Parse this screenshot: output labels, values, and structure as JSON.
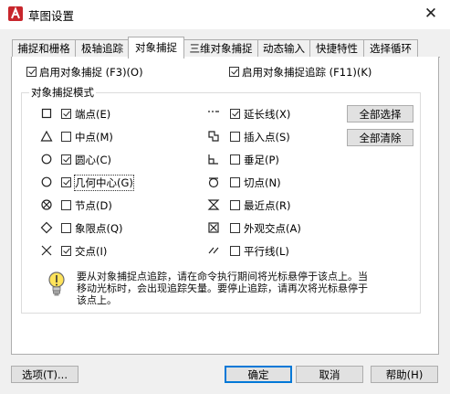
{
  "window": {
    "title": "草图设置",
    "close_glyph": "✕",
    "accent": "#c8262c"
  },
  "tabs": [
    {
      "label": "捕捉和栅格"
    },
    {
      "label": "极轴追踪"
    },
    {
      "label": "对象捕捉"
    },
    {
      "label": "三维对象捕捉"
    },
    {
      "label": "动态输入"
    },
    {
      "label": "快捷特性"
    },
    {
      "label": "选择循环"
    }
  ],
  "toggles": {
    "osnap_on": {
      "label": "启用对象捕捉 (F3)(O)",
      "checked": true
    },
    "otrack_on": {
      "label": "启用对象捕捉追踪 (F11)(K)",
      "checked": true
    }
  },
  "group_title": "对象捕捉模式",
  "modes_left": [
    {
      "label": "端点(E)",
      "checked": true,
      "icon": "endpoint-square-icon"
    },
    {
      "label": "中点(M)",
      "checked": false,
      "icon": "midpoint-triangle-icon"
    },
    {
      "label": "圆心(C)",
      "checked": true,
      "icon": "center-circle-icon"
    },
    {
      "label": "几何中心(G)",
      "checked": true,
      "icon": "geometric-center-icon"
    },
    {
      "label": "节点(D)",
      "checked": false,
      "icon": "node-icon"
    },
    {
      "label": "象限点(Q)",
      "checked": false,
      "icon": "quadrant-diamond-icon"
    },
    {
      "label": "交点(I)",
      "checked": true,
      "icon": "intersection-x-icon"
    }
  ],
  "modes_right": [
    {
      "label": "延长线(X)",
      "checked": true,
      "icon": "extension-icon"
    },
    {
      "label": "插入点(S)",
      "checked": false,
      "icon": "insertion-icon"
    },
    {
      "label": "垂足(P)",
      "checked": false,
      "icon": "perpendicular-icon"
    },
    {
      "label": "切点(N)",
      "checked": false,
      "icon": "tangent-icon"
    },
    {
      "label": "最近点(R)",
      "checked": false,
      "icon": "nearest-icon"
    },
    {
      "label": "外观交点(A)",
      "checked": false,
      "icon": "apparent-intersection-icon"
    },
    {
      "label": "平行线(L)",
      "checked": false,
      "icon": "parallel-icon"
    }
  ],
  "buttons": {
    "select_all": "全部选择",
    "clear_all": "全部清除",
    "options": "选项(T)...",
    "ok": "确定",
    "cancel": "取消",
    "help": "帮助(H)"
  },
  "tip": {
    "icon": "lightbulb-icon",
    "line1": "要从对象捕捉点追踪，请在命令执行期间将光标悬停于该点上。当",
    "line2": "移动光标时，会出现追踪矢量。要停止追踪，请再次将光标悬停于",
    "line3": "该点上。"
  }
}
